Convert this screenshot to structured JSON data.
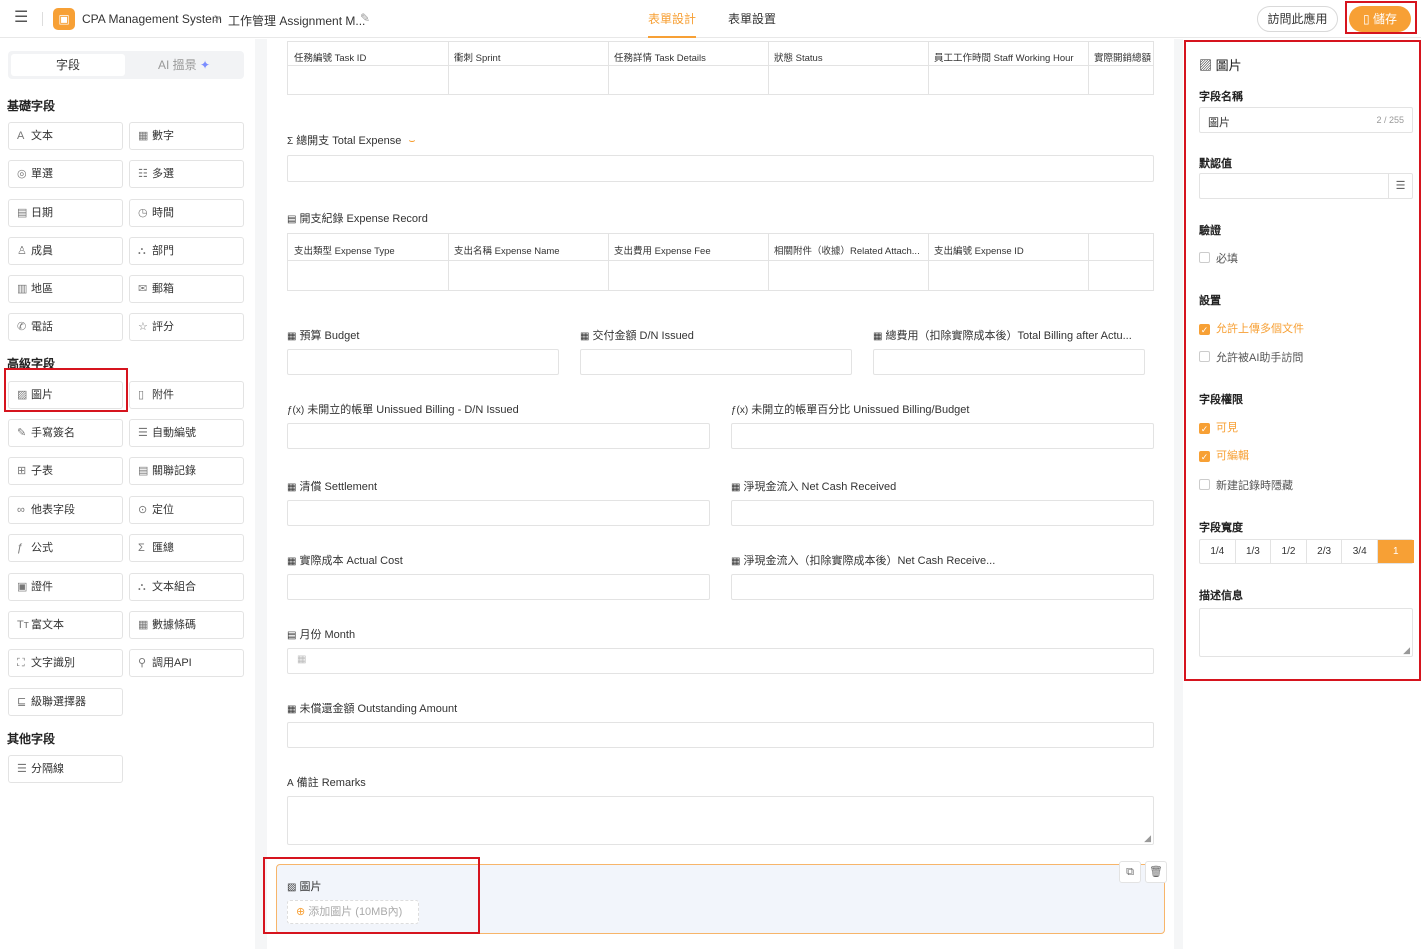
{
  "header": {
    "app_name": "CPA Management System",
    "breadcrumb_sep": ">",
    "page_name": "工作管理 Assignment M...",
    "tabs": [
      "表單設計",
      "表單設置"
    ],
    "active_tab": "表單設計",
    "visit_label": "訪問此應用",
    "save_label": "儲存"
  },
  "left": {
    "tabs": [
      "字段",
      "AI 搵景"
    ],
    "sections": [
      {
        "title": "基礎字段",
        "items": [
          {
            "label": "文本",
            "icon": "text-icon"
          },
          {
            "label": "數字",
            "icon": "number-icon"
          },
          {
            "label": "單選",
            "icon": "radio-icon"
          },
          {
            "label": "多選",
            "icon": "checklist-icon"
          },
          {
            "label": "日期",
            "icon": "calendar-icon"
          },
          {
            "label": "時間",
            "icon": "clock-icon"
          },
          {
            "label": "成員",
            "icon": "person-icon"
          },
          {
            "label": "部門",
            "icon": "org-icon"
          },
          {
            "label": "地區",
            "icon": "map-icon"
          },
          {
            "label": "郵箱",
            "icon": "mail-icon"
          },
          {
            "label": "電話",
            "icon": "phone-icon"
          },
          {
            "label": "評分",
            "icon": "star-icon"
          }
        ]
      },
      {
        "title": "高級字段",
        "items": [
          {
            "label": "圖片",
            "icon": "image-icon"
          },
          {
            "label": "附件",
            "icon": "file-icon"
          },
          {
            "label": "手寫簽名",
            "icon": "pen-icon"
          },
          {
            "label": "自動編號",
            "icon": "list-number-icon"
          },
          {
            "label": "子表",
            "icon": "table-icon"
          },
          {
            "label": "關聯記錄",
            "icon": "link-table-icon"
          },
          {
            "label": "他表字段",
            "icon": "link-icon"
          },
          {
            "label": "定位",
            "icon": "location-icon"
          },
          {
            "label": "公式",
            "icon": "formula-icon"
          },
          {
            "label": "匯總",
            "icon": "sigma-icon"
          },
          {
            "label": "證件",
            "icon": "id-card-icon"
          },
          {
            "label": "文本組合",
            "icon": "combine-icon"
          },
          {
            "label": "富文本",
            "icon": "rich-text-icon"
          },
          {
            "label": "數據條碼",
            "icon": "qr-icon"
          },
          {
            "label": "文字識別",
            "icon": "ocr-icon"
          },
          {
            "label": "調用API",
            "icon": "api-icon"
          },
          {
            "label": "級聯選擇器",
            "icon": "cascade-icon"
          }
        ]
      },
      {
        "title": "其他字段",
        "items": [
          {
            "label": "分隔線",
            "icon": "divider-icon"
          }
        ]
      }
    ]
  },
  "form": {
    "top_table_cols": [
      "任務編號 Task ID",
      "衝刺 Sprint",
      "任務詳情 Task Details",
      "狀態 Status",
      "員工工作時間 Staff Working Hour",
      "實際開銷總額"
    ],
    "total_expense_label": "總開支 Total Expense",
    "expense_record_label": "開支紀錄 Expense Record",
    "expense_cols": [
      "支出類型 Expense Type",
      "支出名稱 Expense Name",
      "支出費用 Expense Fee",
      "相關附件（收據）Related Attach...",
      "支出編號 Expense ID"
    ],
    "budget_label": "預算 Budget",
    "dn_issued_label": "交付金額 D/N Issued",
    "total_billing_label": "總費用（扣除實際成本後）Total Billing after Actu...",
    "unissued_billing_label": "未開立的帳單 Unissued Billing - D/N Issued",
    "unissued_pct_label": "未開立的帳單百分比 Unissued Billing/Budget",
    "settlement_label": "清償 Settlement",
    "net_cash_label": "淨現金流入 Net Cash Received",
    "actual_cost_label": "實際成本 Actual Cost",
    "net_cash_after_label": "淨現金流入（扣除實際成本後）Net Cash Receive...",
    "month_label": "月份 Month",
    "outstanding_label": "未償還金額 Outstanding Amount",
    "remarks_label": "備註 Remarks",
    "image_field_label": "圖片",
    "add_image_label": "添加圖片 (10MB內)"
  },
  "right": {
    "title": "圖片",
    "field_name_label": "字段名稱",
    "field_name_value": "圖片",
    "field_name_count": "2 / 255",
    "default_label": "默認值",
    "validation_label": "驗證",
    "required_label": "必填",
    "settings_label": "設置",
    "allow_multi_label": "允許上傳多個文件",
    "allow_ai_label": "允許被AI助手訪問",
    "permission_label": "字段權限",
    "visible_label": "可見",
    "editable_label": "可編輯",
    "hide_new_label": "新建記錄時隱藏",
    "width_label": "字段寬度",
    "width_options": [
      "1/4",
      "1/3",
      "1/2",
      "2/3",
      "3/4",
      "1"
    ],
    "width_selected": "1",
    "desc_label": "描述信息"
  },
  "colors": {
    "accent": "#f7a035",
    "highlight_box": "#d6141e"
  }
}
